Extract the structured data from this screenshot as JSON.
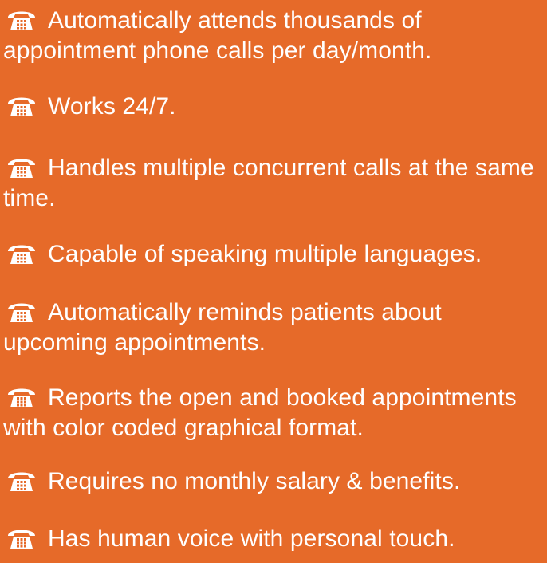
{
  "colors": {
    "background": "#e66a29",
    "text": "#ffffff",
    "icon": "#ffffff"
  },
  "icon": "telephone-icon",
  "features": [
    {
      "text": "Automatically attends thousands of appointment phone calls per day/month."
    },
    {
      "text": "Works 24/7."
    },
    {
      "text": "Handles multiple concurrent calls at the same time."
    },
    {
      "text": "Capable of speaking multiple languages."
    },
    {
      "text": "Automatically reminds patients about upcoming appointments."
    },
    {
      "text": "Reports the open and booked appointments with color coded graphical format."
    },
    {
      "text": "Requires no monthly salary & benefits."
    },
    {
      "text": "Has human voice with personal touch."
    }
  ]
}
